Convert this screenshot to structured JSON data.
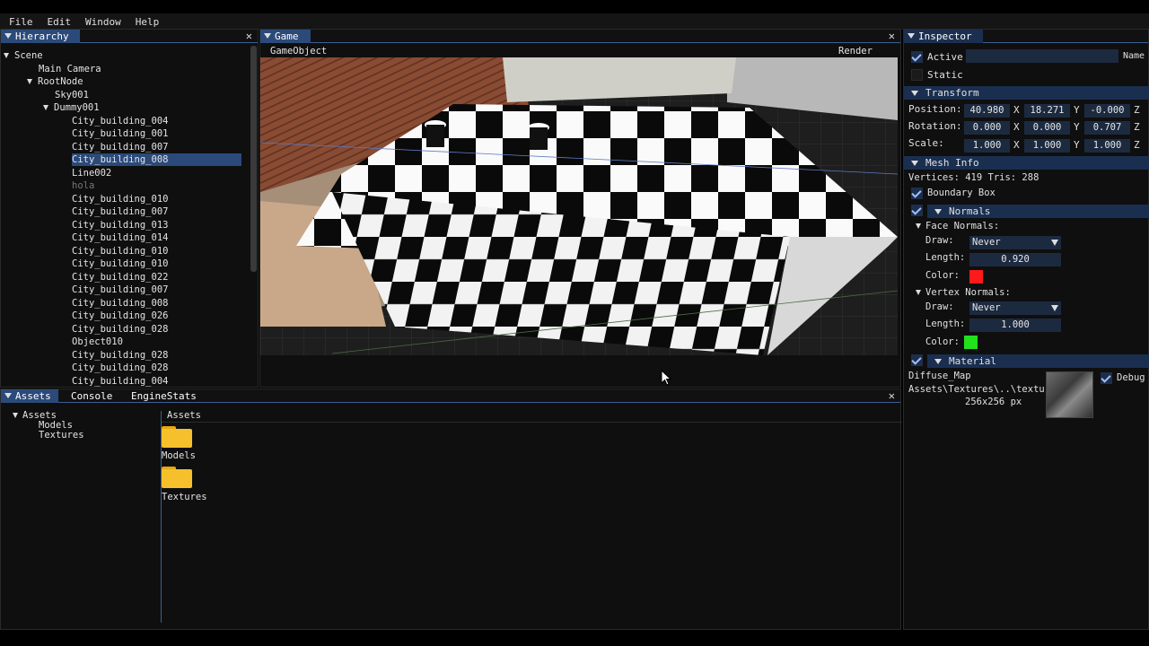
{
  "menu": [
    "File",
    "Edit",
    "Window",
    "Help"
  ],
  "hierarchy": {
    "title": "Hierarchy",
    "items": [
      {
        "label": "Scene",
        "level": 0,
        "expanded": true
      },
      {
        "label": "Main Camera",
        "level": 1
      },
      {
        "label": "RootNode",
        "level": 1,
        "expanded": true
      },
      {
        "label": "Sky001",
        "level": 2
      },
      {
        "label": "Dummy001",
        "level": 2,
        "expanded": true
      },
      {
        "label": "City_building_004",
        "level": 3
      },
      {
        "label": "City_building_001",
        "level": 3
      },
      {
        "label": "City_building_007",
        "level": 3
      },
      {
        "label": "City_building_008",
        "level": 3,
        "selected": true
      },
      {
        "label": "Line002",
        "level": 3
      },
      {
        "label": "hola",
        "level": 3,
        "dim": true
      },
      {
        "label": "City_building_010",
        "level": 3
      },
      {
        "label": "City_building_007",
        "level": 3
      },
      {
        "label": "City_building_013",
        "level": 3
      },
      {
        "label": "City_building_014",
        "level": 3
      },
      {
        "label": "City_building_010",
        "level": 3
      },
      {
        "label": "City_building_010",
        "level": 3
      },
      {
        "label": "City_building_022",
        "level": 3
      },
      {
        "label": "City_building_007",
        "level": 3
      },
      {
        "label": "City_building_008",
        "level": 3
      },
      {
        "label": "City_building_026",
        "level": 3
      },
      {
        "label": "City_building_028",
        "level": 3
      },
      {
        "label": "Object010",
        "level": 3
      },
      {
        "label": "City_building_028",
        "level": 3
      },
      {
        "label": "City_building_028",
        "level": 3
      },
      {
        "label": "City_building_004",
        "level": 3
      }
    ]
  },
  "game": {
    "title": "Game",
    "toolbar_left": "GameObject",
    "toolbar_right": "Render"
  },
  "inspector": {
    "title": "Inspector",
    "active_label": "Active",
    "active_checked": true,
    "name_value": "",
    "name_label": "Name",
    "static_label": "Static",
    "static_checked": false,
    "transform": {
      "header": "Transform",
      "position_label": "Position:",
      "position": [
        "40.980",
        "18.271",
        "-0.000"
      ],
      "rotation_label": "Rotation:",
      "rotation": [
        "0.000",
        "0.000",
        "0.707"
      ],
      "scale_label": "Scale:",
      "scale": [
        "1.000",
        "1.000",
        "1.000"
      ],
      "axes": [
        "X",
        "Y",
        "Z"
      ]
    },
    "mesh_info": {
      "header": "Mesh Info",
      "stats": "Vertices: 419  Tris: 288",
      "boundary_box_label": "Boundary Box",
      "boundary_box_checked": true
    },
    "normals": {
      "header": "Normals",
      "enabled": true,
      "face": {
        "label": "Face Normals:",
        "draw_label": "Draw:",
        "draw_value": "Never",
        "length_label": "Length:",
        "length_value": "0.920",
        "color_label": "Color:",
        "color": "#ff1a1a"
      },
      "vertex": {
        "label": "Vertex Normals:",
        "draw_label": "Draw:",
        "draw_value": "Never",
        "length_label": "Length:",
        "length_value": "1.000",
        "color_label": "Color:",
        "color": "#22e01c"
      }
    },
    "material": {
      "header": "Material",
      "enabled": true,
      "map_label": "Diffuse_Map",
      "path": "Assets\\Textures\\..\\textu",
      "size": "256x256 px",
      "debug_label": "Debug",
      "debug_checked": true
    }
  },
  "bottom": {
    "tabs": [
      "Assets",
      "Console",
      "EngineStats"
    ],
    "tree": [
      "Assets",
      "Models",
      "Textures"
    ],
    "breadcrumb": "Assets",
    "folders": [
      "Models",
      "Textures"
    ]
  },
  "colors": {
    "accent": "#2b4a7a",
    "folder": "#f5c02c"
  }
}
